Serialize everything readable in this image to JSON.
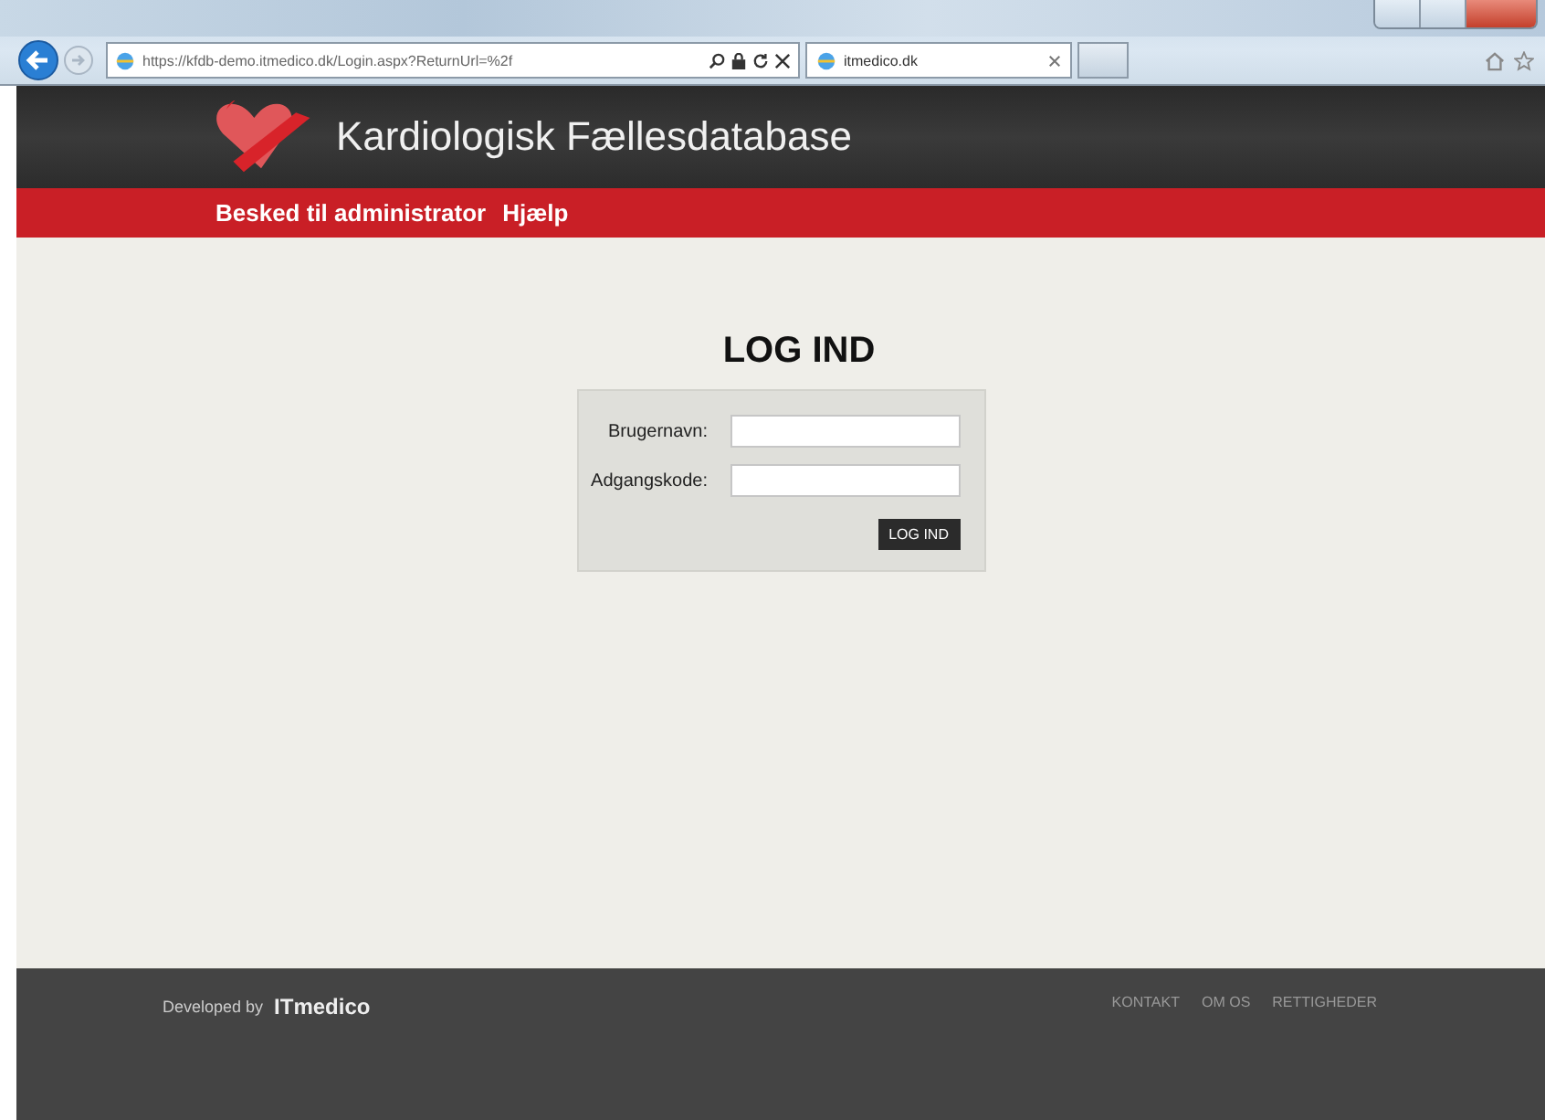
{
  "browser": {
    "url": "https://kfdb-demo.itmedico.dk/Login.aspx?ReturnUrl=%2f",
    "tab_title": "itmedico.dk"
  },
  "header": {
    "title": "Kardiologisk Fællesdatabase"
  },
  "nav": [
    {
      "label": "Besked til administrator"
    },
    {
      "label": "Hjælp"
    }
  ],
  "login": {
    "heading": "LOG IND",
    "fields": [
      {
        "label": "Brugernavn:"
      },
      {
        "label": "Adgangskode:"
      }
    ],
    "button": "LOG IND"
  },
  "footer": {
    "developed_by": "Developed by",
    "brand": "ITmedico",
    "links": [
      "KONTAKT",
      "OM OS",
      "RETTIGHEDER"
    ]
  }
}
